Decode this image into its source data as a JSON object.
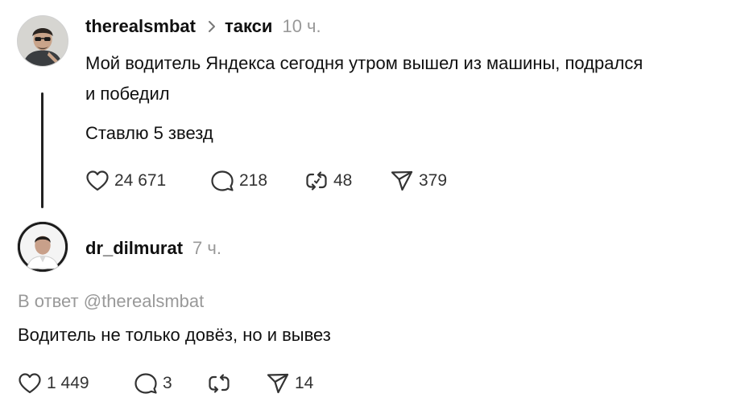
{
  "post": {
    "username": "therealsmbat",
    "topic": "такси",
    "time": "10 ч.",
    "text_line1": "Мой водитель Яндекса сегодня утром вышел из машины, подрался",
    "text_line2": "и победил",
    "text_extra": "Ставлю 5 звезд",
    "likes": "24 671",
    "replies": "218",
    "reposts": "48",
    "shares": "379"
  },
  "reply": {
    "username": "dr_dilmurat",
    "time": "7 ч.",
    "reply_to": "В ответ @therealsmbat",
    "text": "Водитель не только довёз, но и вывез",
    "likes": "1 449",
    "replies": "3",
    "shares": "14"
  },
  "icons": {
    "like": "heart-icon",
    "reply": "comment-bubble-icon",
    "repost": "repost-icon",
    "share": "paper-plane-icon",
    "topic_separator": "chevron-right-icon"
  },
  "colors": {
    "text": "#101010",
    "secondary": "#999999",
    "icon": "#333333"
  }
}
